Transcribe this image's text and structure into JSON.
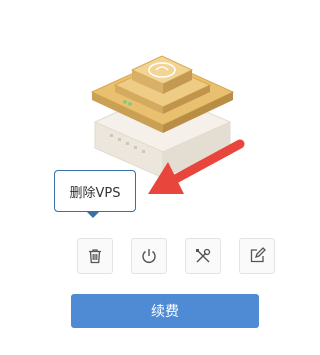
{
  "tooltip": {
    "text": "删除VPS"
  },
  "actions": [
    {
      "name": "delete",
      "icon": "trash-icon"
    },
    {
      "name": "power",
      "icon": "power-icon"
    },
    {
      "name": "settings",
      "icon": "tools-icon"
    },
    {
      "name": "edit",
      "icon": "edit-icon"
    }
  ],
  "renew": {
    "label": "续费"
  },
  "colors": {
    "accent": "#4f8bd4",
    "arrow": "#e8453c",
    "tooltip_border": "#3a6ea5"
  }
}
